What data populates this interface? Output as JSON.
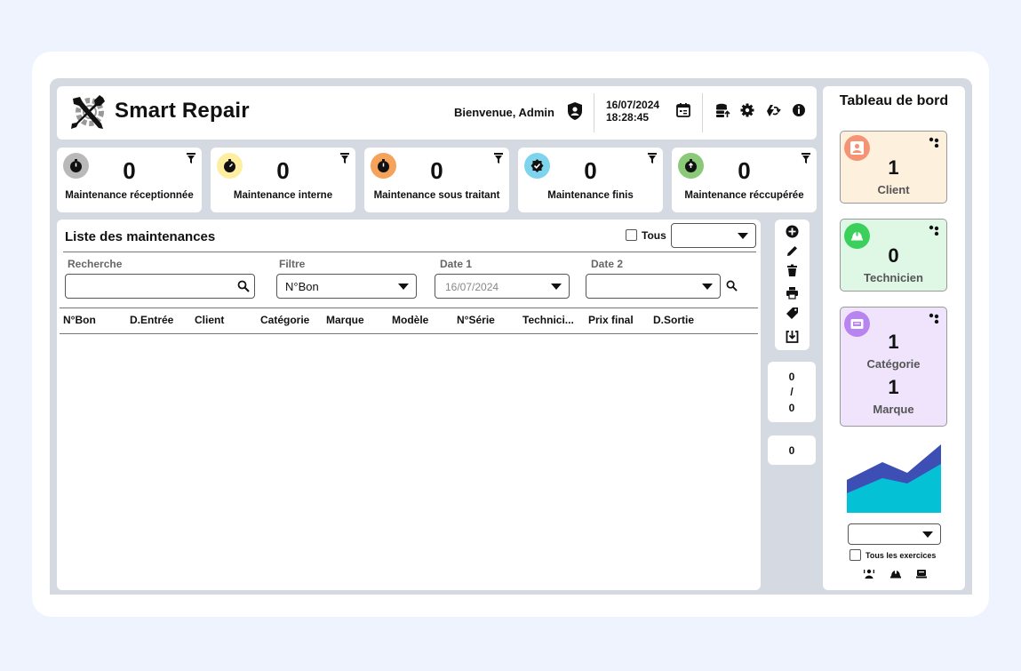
{
  "app": {
    "title": "Smart Repair"
  },
  "header": {
    "welcome": "Bienvenue, Admin",
    "date": "16/07/2024",
    "time": "18:28:45",
    "icons": [
      "shield-user-icon",
      "calendar-icon",
      "database-upload-icon",
      "gear-icon",
      "sync-icon",
      "info-icon"
    ]
  },
  "stats": [
    {
      "label": "Maintenance réceptionnée",
      "value": "0",
      "color": "#b9b9b9"
    },
    {
      "label": "Maintenance interne",
      "value": "0",
      "color": "#fdeea0"
    },
    {
      "label": "Maintenance sous traitant",
      "value": "0",
      "color": "#f5a25a"
    },
    {
      "label": "Maintenance finis",
      "value": "0",
      "color": "#7dd4ec"
    },
    {
      "label": "Maintenance réccupérée",
      "value": "0",
      "color": "#89c978"
    }
  ],
  "list": {
    "title": "Liste des maintenances",
    "tous_label": "Tous",
    "tous_select": "",
    "filters": {
      "search_label": "Recherche",
      "search_value": "",
      "filter_label": "Filtre",
      "filter_value": "N°Bon",
      "date1_label": "Date 1",
      "date1_value": "16/07/2024",
      "date2_label": "Date 2",
      "date2_value": ""
    },
    "columns": [
      "N°Bon",
      "D.Entrée",
      "Client",
      "Catégorie",
      "Marque",
      "Modèle",
      "N°Série",
      "Technici...",
      "Prix final",
      "D.Sortie"
    ],
    "rows": []
  },
  "tools": [
    "add-icon",
    "edit-icon",
    "delete-icon",
    "print-icon",
    "tag-icon",
    "download-icon"
  ],
  "pager": {
    "current": "0",
    "sep": "/",
    "total": "0"
  },
  "count": "0",
  "dashboard": {
    "title": "Tableau de bord",
    "cards": [
      {
        "label": "Client",
        "value": "1",
        "bg": "#fdf1dd",
        "circle": "#f49475"
      },
      {
        "label": "Technicien",
        "value": "0",
        "bg": "#def8e5",
        "circle": "#3bcf5c"
      },
      {
        "label": "Catégorie",
        "value": "1",
        "label2": "Marque",
        "value2": "1",
        "bg": "#efe4fb",
        "circle": "#b784f0"
      }
    ],
    "chart_colors": [
      "#3d4fb5",
      "#05c1d6"
    ],
    "year_select": "",
    "all_years_label": "Tous les exercices"
  }
}
